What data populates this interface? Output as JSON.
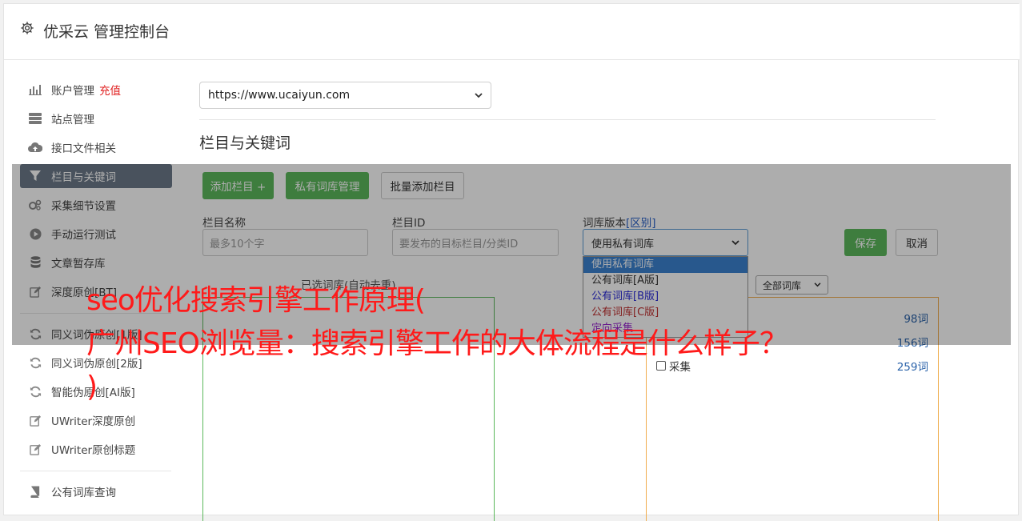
{
  "header": {
    "title": "优采云 管理控制台"
  },
  "sidebar": {
    "items": [
      {
        "label": "账户管理",
        "badge": "充值",
        "icon": "bar-chart-icon"
      },
      {
        "label": "站点管理",
        "icon": "server-icon"
      },
      {
        "label": "接口文件相关",
        "icon": "cloud-upload-icon"
      },
      {
        "label": "栏目与关键词",
        "icon": "filter-icon",
        "active": true
      },
      {
        "label": "采集细节设置",
        "icon": "cogs-icon"
      },
      {
        "label": "手动运行测试",
        "icon": "play-circle-icon"
      },
      {
        "label": "文章暂存库",
        "icon": "database-icon"
      },
      {
        "label": "深度原创[BT]",
        "icon": "edit-icon"
      }
    ],
    "items2": [
      {
        "label": "同义词伪原创[1版]",
        "icon": "refresh-icon"
      },
      {
        "label": "同义词伪原创[2版]",
        "icon": "refresh-icon"
      },
      {
        "label": "智能伪原创[AI版]",
        "icon": "refresh-icon"
      },
      {
        "label": "UWriter深度原创",
        "icon": "edit-icon"
      },
      {
        "label": "UWriter原创标题",
        "icon": "edit-icon"
      }
    ],
    "items3": [
      {
        "label": "公有词库查询",
        "icon": "book-icon"
      }
    ]
  },
  "main": {
    "site_select": "https://www.ucaiyun.com",
    "section_title": "栏目与关键词",
    "buttons": {
      "add_column": "添加栏目 +",
      "private_lib": "私有词库管理",
      "batch_add": "批量添加栏目"
    },
    "form": {
      "name_label": "栏目名称",
      "name_placeholder": "最多10个字",
      "id_label": "栏目ID",
      "id_placeholder": "要发布的目标栏目/分类ID",
      "version_label": "词库版本",
      "version_label_link": "[区别]",
      "version_value": "使用私有词库",
      "save": "保存",
      "cancel": "取消"
    },
    "dropdown": [
      "使用私有词库",
      "公有词库[A版]",
      "公有词库[B版]",
      "公有词库[C版]",
      "定向采集"
    ],
    "selected_words_title": "已选词库(自动去重)",
    "lib_filter": "全部词库",
    "word_list": [
      {
        "label": "",
        "count": "98词"
      },
      {
        "label": "",
        "count": "156词"
      },
      {
        "label": "采集",
        "count": "259词"
      }
    ]
  },
  "overlay": {
    "line1": "seo优化搜索引擎工作原理(",
    "line2": "广州SEO浏览量：搜索引擎工作的大体流程是什么样子？",
    "line3": ")"
  }
}
